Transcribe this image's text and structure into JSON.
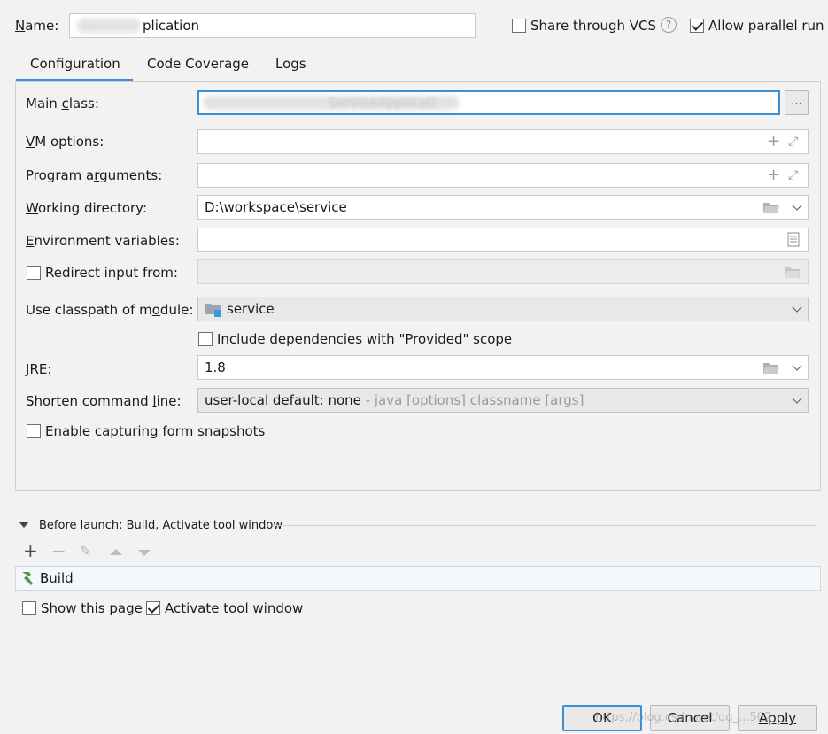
{
  "header": {
    "name_label": "Name:",
    "name_value": "plication",
    "share_vcs_label": "Share through VCS",
    "share_vcs_checked": false,
    "help_glyph": "?",
    "allow_parallel_label": "Allow parallel run",
    "allow_parallel_checked": true
  },
  "tabs": [
    {
      "label": "Configuration",
      "active": true
    },
    {
      "label": "Code Coverage",
      "active": false
    },
    {
      "label": "Logs",
      "active": false
    }
  ],
  "form": {
    "main_class_label": "Main class:",
    "main_class_value": "ServiceApplicati",
    "browse_label": "...",
    "vm_options_label": "VM options:",
    "vm_options_value": "",
    "program_args_label": "Program arguments:",
    "program_args_value": "",
    "working_dir_label": "Working directory:",
    "working_dir_value": "D:\\workspace\\service",
    "env_vars_label": "Environment variables:",
    "env_vars_value": "",
    "redirect_label": "Redirect input from:",
    "redirect_checked": false,
    "classpath_label": "Use classpath of module:",
    "classpath_value": "service",
    "include_deps_label": "Include dependencies with \"Provided\" scope",
    "include_deps_checked": false,
    "jre_label": "JRE:",
    "jre_value": "1.8",
    "shorten_label": "Shorten command line:",
    "shorten_value": "user-local default: none",
    "shorten_hint": " - java [options] classname [args]",
    "snapshots_label": "Enable capturing form snapshots",
    "snapshots_checked": false
  },
  "before_launch": {
    "title": "Before launch: Build, Activate tool window",
    "items": [
      {
        "label": "Build"
      }
    ],
    "show_page_label": "Show this page",
    "show_page_checked": false,
    "activate_label": "Activate tool window",
    "activate_checked": true
  },
  "footer": {
    "ok_label": "OK",
    "cancel_label": "Cancel",
    "apply_label": "Apply",
    "watermark": "https://blog.csdn.net/qq_...502"
  },
  "colors": {
    "accent": "#3a8fd6",
    "build_icon": "#4a9a4a",
    "folder_icon": "#9aa7b3"
  }
}
